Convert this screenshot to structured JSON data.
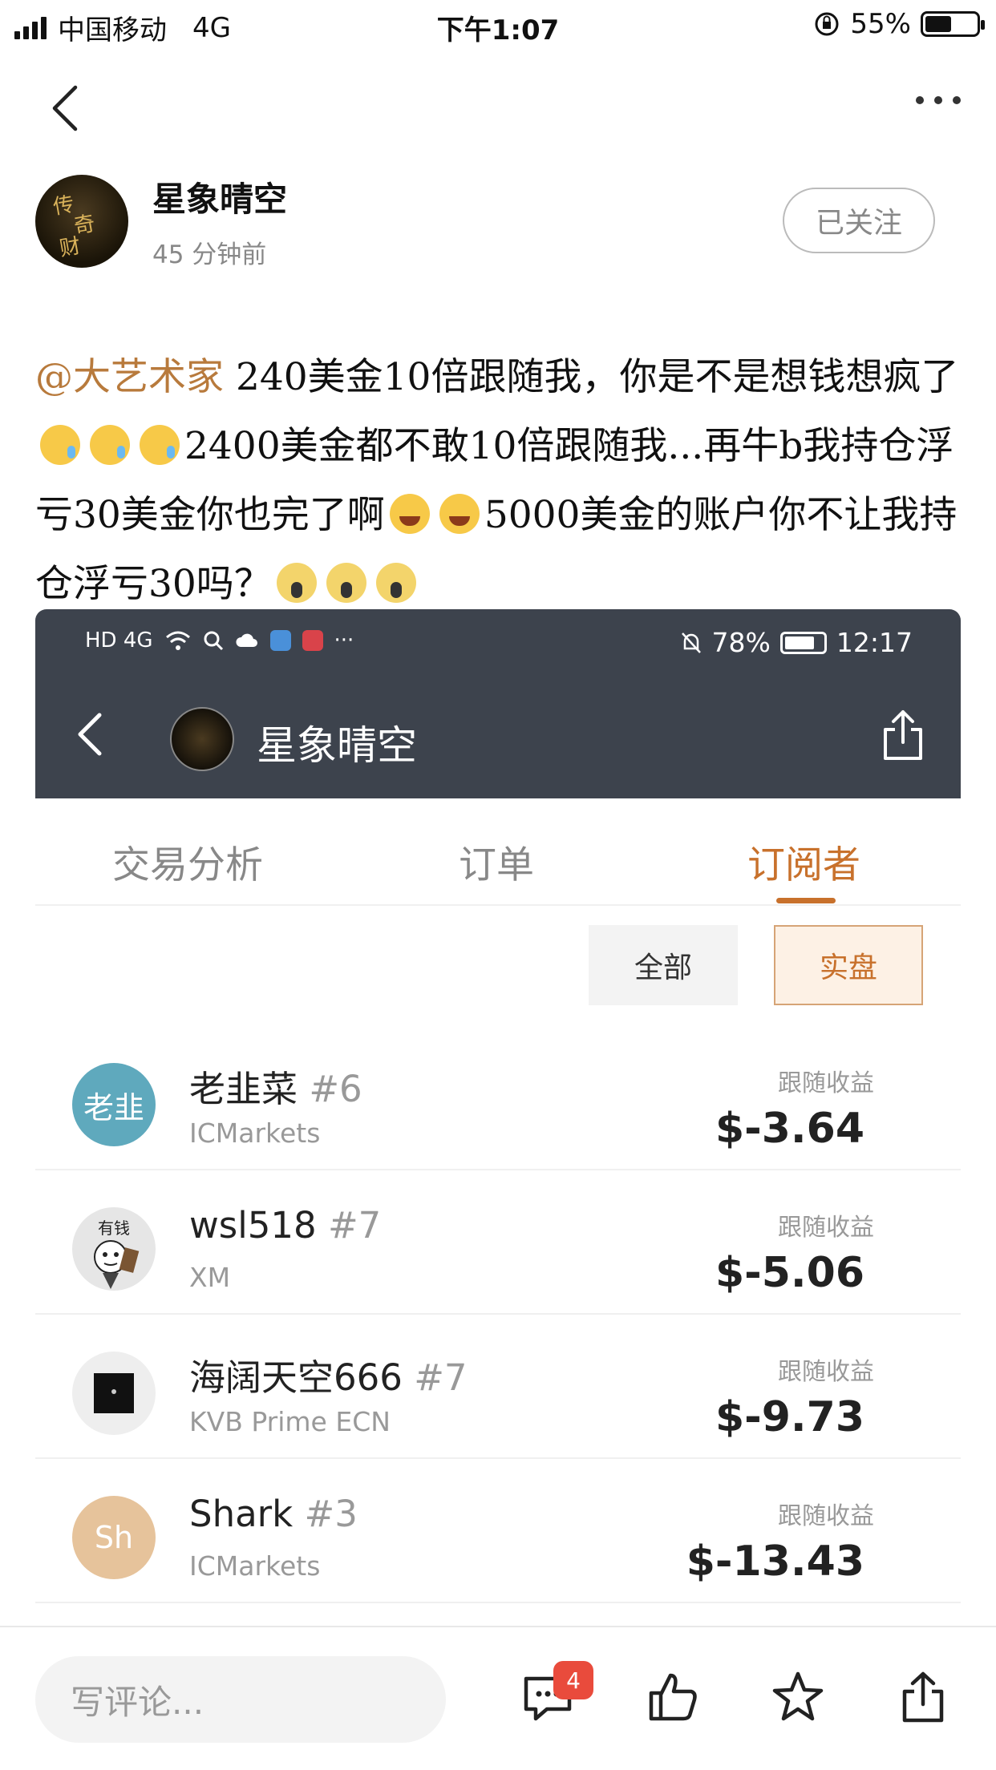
{
  "status_bar": {
    "carrier": "中国移动",
    "network": "4G",
    "time": "下午1:07",
    "battery": "55%"
  },
  "author": {
    "name": "星象晴空",
    "time_ago": "45 分钟前",
    "follow_label": "已关注"
  },
  "post": {
    "mention": "@大艺术家",
    "segments": [
      " 240美金10倍跟随我，你是不是想钱想疯了",
      "2400美金都不敢10倍跟随我...再牛b我持仓浮亏30美金你也完了啊",
      "5000美金的账户你不让我持仓浮亏30吗？"
    ]
  },
  "embedded": {
    "status": {
      "left": "HD 4G",
      "battery": "78%",
      "time": "12:17"
    },
    "title": "星象晴空",
    "tabs": [
      "交易分析",
      "订单",
      "订阅者"
    ],
    "active_tab": "订阅者",
    "filters": {
      "all": "全部",
      "real": "实盘"
    },
    "subscribers": [
      {
        "name": "老韭菜",
        "rank": "#6",
        "broker": "ICMarkets",
        "profit_label": "跟随收益",
        "profit": "$-3.64",
        "avatar_text": "老韭",
        "avatar_color": "#5fa9bd"
      },
      {
        "name": "wsl518",
        "rank": "#7",
        "broker": "XM",
        "profit_label": "跟随收益",
        "profit": "$-5.06",
        "avatar_text": "有钱",
        "avatar_color": "#e6e6e6"
      },
      {
        "name": "海阔天空666",
        "rank": "#7",
        "broker": "KVB Prime ECN",
        "profit_label": "跟随收益",
        "profit": "$-9.73",
        "avatar_text": "",
        "avatar_color": "#eeeeee"
      },
      {
        "name": "Shark",
        "rank": "#3",
        "broker": "ICMarkets",
        "profit_label": "跟随收益",
        "profit": "$-13.43",
        "avatar_text": "Sh",
        "avatar_color": "#e6c39b"
      }
    ]
  },
  "bottom_bar": {
    "comment_placeholder": "写评论...",
    "comment_count": "4"
  },
  "colors": {
    "accent": "#c8712c",
    "mention": "#b87a3c",
    "header_bg": "#3d434d",
    "badge": "#e94b3c"
  }
}
